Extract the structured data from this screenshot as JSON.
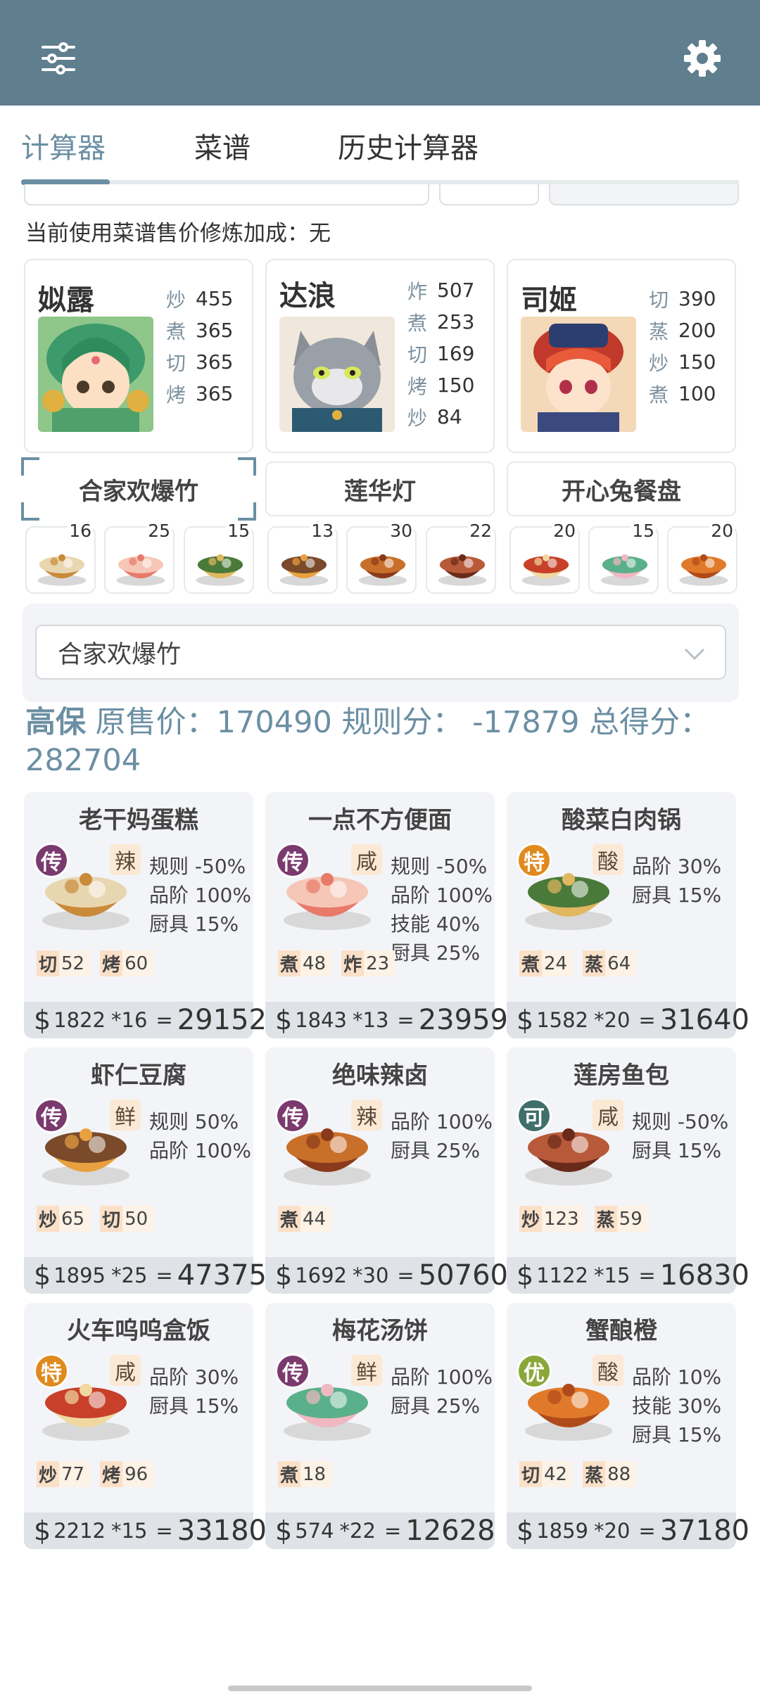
{
  "header": {
    "menu_icon": "sliders-icon",
    "settings_icon": "gear-icon",
    "bg_color": "#5f7e8e"
  },
  "tabs": [
    {
      "label": "计算器"
    },
    {
      "label": "菜谱"
    },
    {
      "label": "历史计算器"
    }
  ],
  "bonus_text": "当前使用菜谱售价修炼加成：无",
  "chefs": [
    {
      "name": "姒露",
      "skills": [
        {
          "k": "炒",
          "v": "455"
        },
        {
          "k": "煮",
          "v": "365"
        },
        {
          "k": "切",
          "v": "365"
        },
        {
          "k": "烤",
          "v": "365"
        }
      ]
    },
    {
      "name": "达浪",
      "skills": [
        {
          "k": "炸",
          "v": "507"
        },
        {
          "k": "煮",
          "v": "253"
        },
        {
          "k": "切",
          "v": "169"
        },
        {
          "k": "烤",
          "v": "150"
        },
        {
          "k": "炒",
          "v": "84"
        }
      ]
    },
    {
      "name": "司姬",
      "skills": [
        {
          "k": "切",
          "v": "390"
        },
        {
          "k": "蒸",
          "v": "200"
        },
        {
          "k": "炒",
          "v": "150"
        },
        {
          "k": "煮",
          "v": "100"
        }
      ]
    }
  ],
  "categories": [
    {
      "label": "合家欢爆竹"
    },
    {
      "label": "莲华灯"
    },
    {
      "label": "开心兔餐盘"
    }
  ],
  "mini_counts": [
    "16",
    "25",
    "15",
    "13",
    "30",
    "22",
    "20",
    "15",
    "20"
  ],
  "select": {
    "value": "合家欢爆竹"
  },
  "summary": {
    "grade": "高保",
    "line": " 原售价：170490 规则分： -17879 总得分：",
    "total": "282704"
  },
  "dishes": [
    {
      "name": "老干妈蛋糕",
      "grade": "传",
      "flavor": "辣",
      "buffs": [
        "规则 -50%",
        "品阶 100%",
        "厨具 15%"
      ],
      "reqs": [
        {
          "k": "切",
          "v": "52"
        },
        {
          "k": "烤",
          "v": "60"
        }
      ],
      "price": "1822",
      "mult": "*16",
      "total": "29152"
    },
    {
      "name": "一点不方便面",
      "grade": "传",
      "flavor": "咸",
      "buffs": [
        "规则 -50%",
        "品阶 100%",
        "技能 40%",
        "厨具 25%"
      ],
      "reqs": [
        {
          "k": "煮",
          "v": "48"
        },
        {
          "k": "炸",
          "v": "23"
        }
      ],
      "price": "1843",
      "mult": "*13",
      "total": "23959"
    },
    {
      "name": "酸菜白肉锅",
      "grade": "特",
      "flavor": "酸",
      "buffs": [
        "品阶 30%",
        "厨具 15%"
      ],
      "reqs": [
        {
          "k": "煮",
          "v": "24"
        },
        {
          "k": "蒸",
          "v": "64"
        }
      ],
      "price": "1582",
      "mult": "*20",
      "total": "31640"
    },
    {
      "name": "虾仁豆腐",
      "grade": "传",
      "flavor": "鲜",
      "buffs": [
        "规则 50%",
        "品阶 100%"
      ],
      "reqs": [
        {
          "k": "炒",
          "v": "65"
        },
        {
          "k": "切",
          "v": "50"
        }
      ],
      "price": "1895",
      "mult": "*25",
      "total": "47375"
    },
    {
      "name": "绝味辣卤",
      "grade": "传",
      "flavor": "辣",
      "buffs": [
        "品阶 100%",
        "厨具 25%"
      ],
      "reqs": [
        {
          "k": "煮",
          "v": "44"
        }
      ],
      "price": "1692",
      "mult": "*30",
      "total": "50760"
    },
    {
      "name": "莲房鱼包",
      "grade": "可",
      "flavor": "咸",
      "buffs": [
        "规则 -50%",
        "厨具 15%"
      ],
      "reqs": [
        {
          "k": "炒",
          "v": "123"
        },
        {
          "k": "蒸",
          "v": "59"
        }
      ],
      "price": "1122",
      "mult": "*15",
      "total": "16830"
    },
    {
      "name": "火车呜呜盒饭",
      "grade": "特",
      "flavor": "咸",
      "buffs": [
        "品阶 30%",
        "厨具 15%"
      ],
      "reqs": [
        {
          "k": "炒",
          "v": "77"
        },
        {
          "k": "烤",
          "v": "96"
        }
      ],
      "price": "2212",
      "mult": "*15",
      "total": "33180"
    },
    {
      "name": "梅花汤饼",
      "grade": "传",
      "flavor": "鲜",
      "buffs": [
        "品阶 100%",
        "厨具 25%"
      ],
      "reqs": [
        {
          "k": "煮",
          "v": "18"
        }
      ],
      "price": "574",
      "mult": "*22",
      "total": "12628"
    },
    {
      "name": "蟹酿橙",
      "grade": "优",
      "flavor": "酸",
      "buffs": [
        "品阶 10%",
        "技能 30%",
        "厨具 15%"
      ],
      "reqs": [
        {
          "k": "切",
          "v": "42"
        },
        {
          "k": "蒸",
          "v": "88"
        }
      ],
      "price": "1859",
      "mult": "*20",
      "total": "37180"
    }
  ],
  "currency_symbol": "$",
  "equals": "=",
  "grade_colors": {
    "传": "#7a3a6e",
    "特": "#e08a1e",
    "可": "#3f6f6a",
    "优": "#8aa83a"
  }
}
